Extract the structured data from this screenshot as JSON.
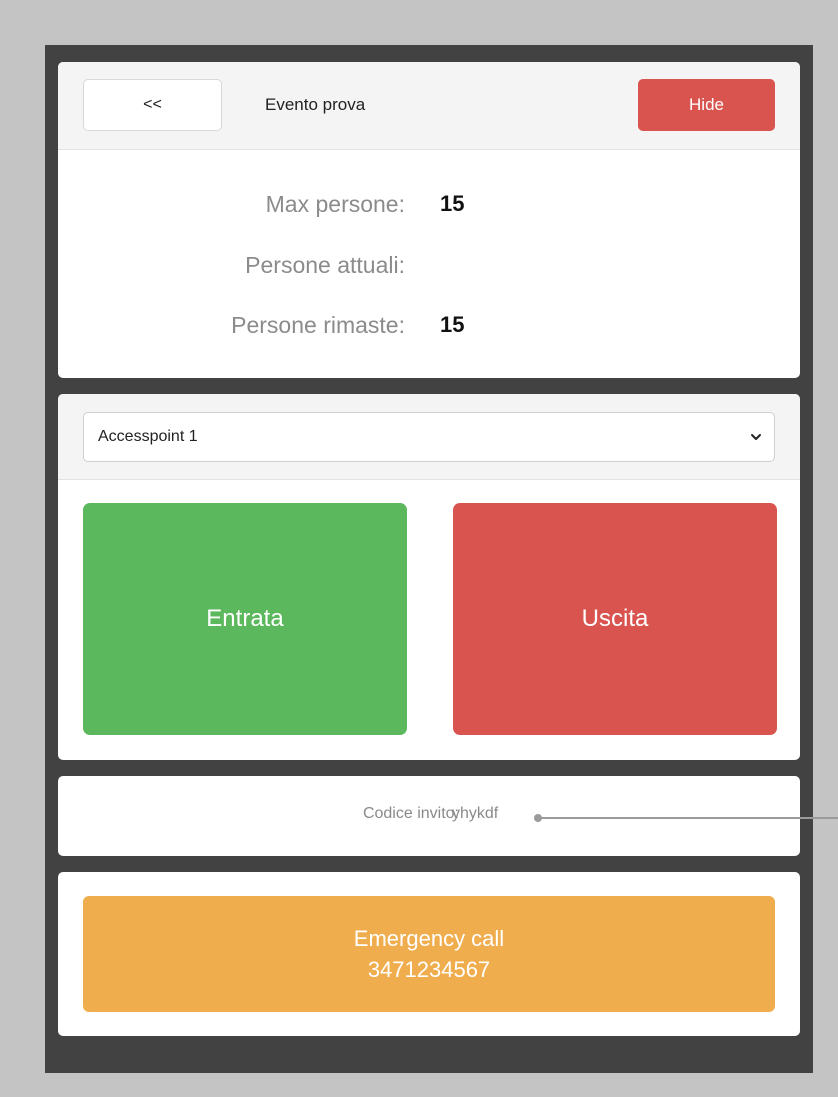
{
  "header": {
    "back_label": "<<",
    "event_title": "Evento prova",
    "hide_label": "Hide"
  },
  "stats": {
    "max_label": "Max persone:",
    "max_value": "15",
    "current_label": "Persone attuali:",
    "current_value": "",
    "remaining_label": "Persone rimaste:",
    "remaining_value": "15"
  },
  "access": {
    "selected": "Accesspoint 1"
  },
  "actions": {
    "enter_label": "Entrata",
    "exit_label": "Uscita"
  },
  "invite": {
    "label": "Codice invito:",
    "code": "yhykdf"
  },
  "emergency": {
    "title": "Emergency call",
    "phone": "3471234567"
  },
  "colors": {
    "background": "#c4c4c4",
    "frame": "#424242",
    "danger": "#d9534f",
    "success": "#5cb85c",
    "warning": "#f0ad4e",
    "icons": [
      "chevron-down-icon"
    ]
  }
}
